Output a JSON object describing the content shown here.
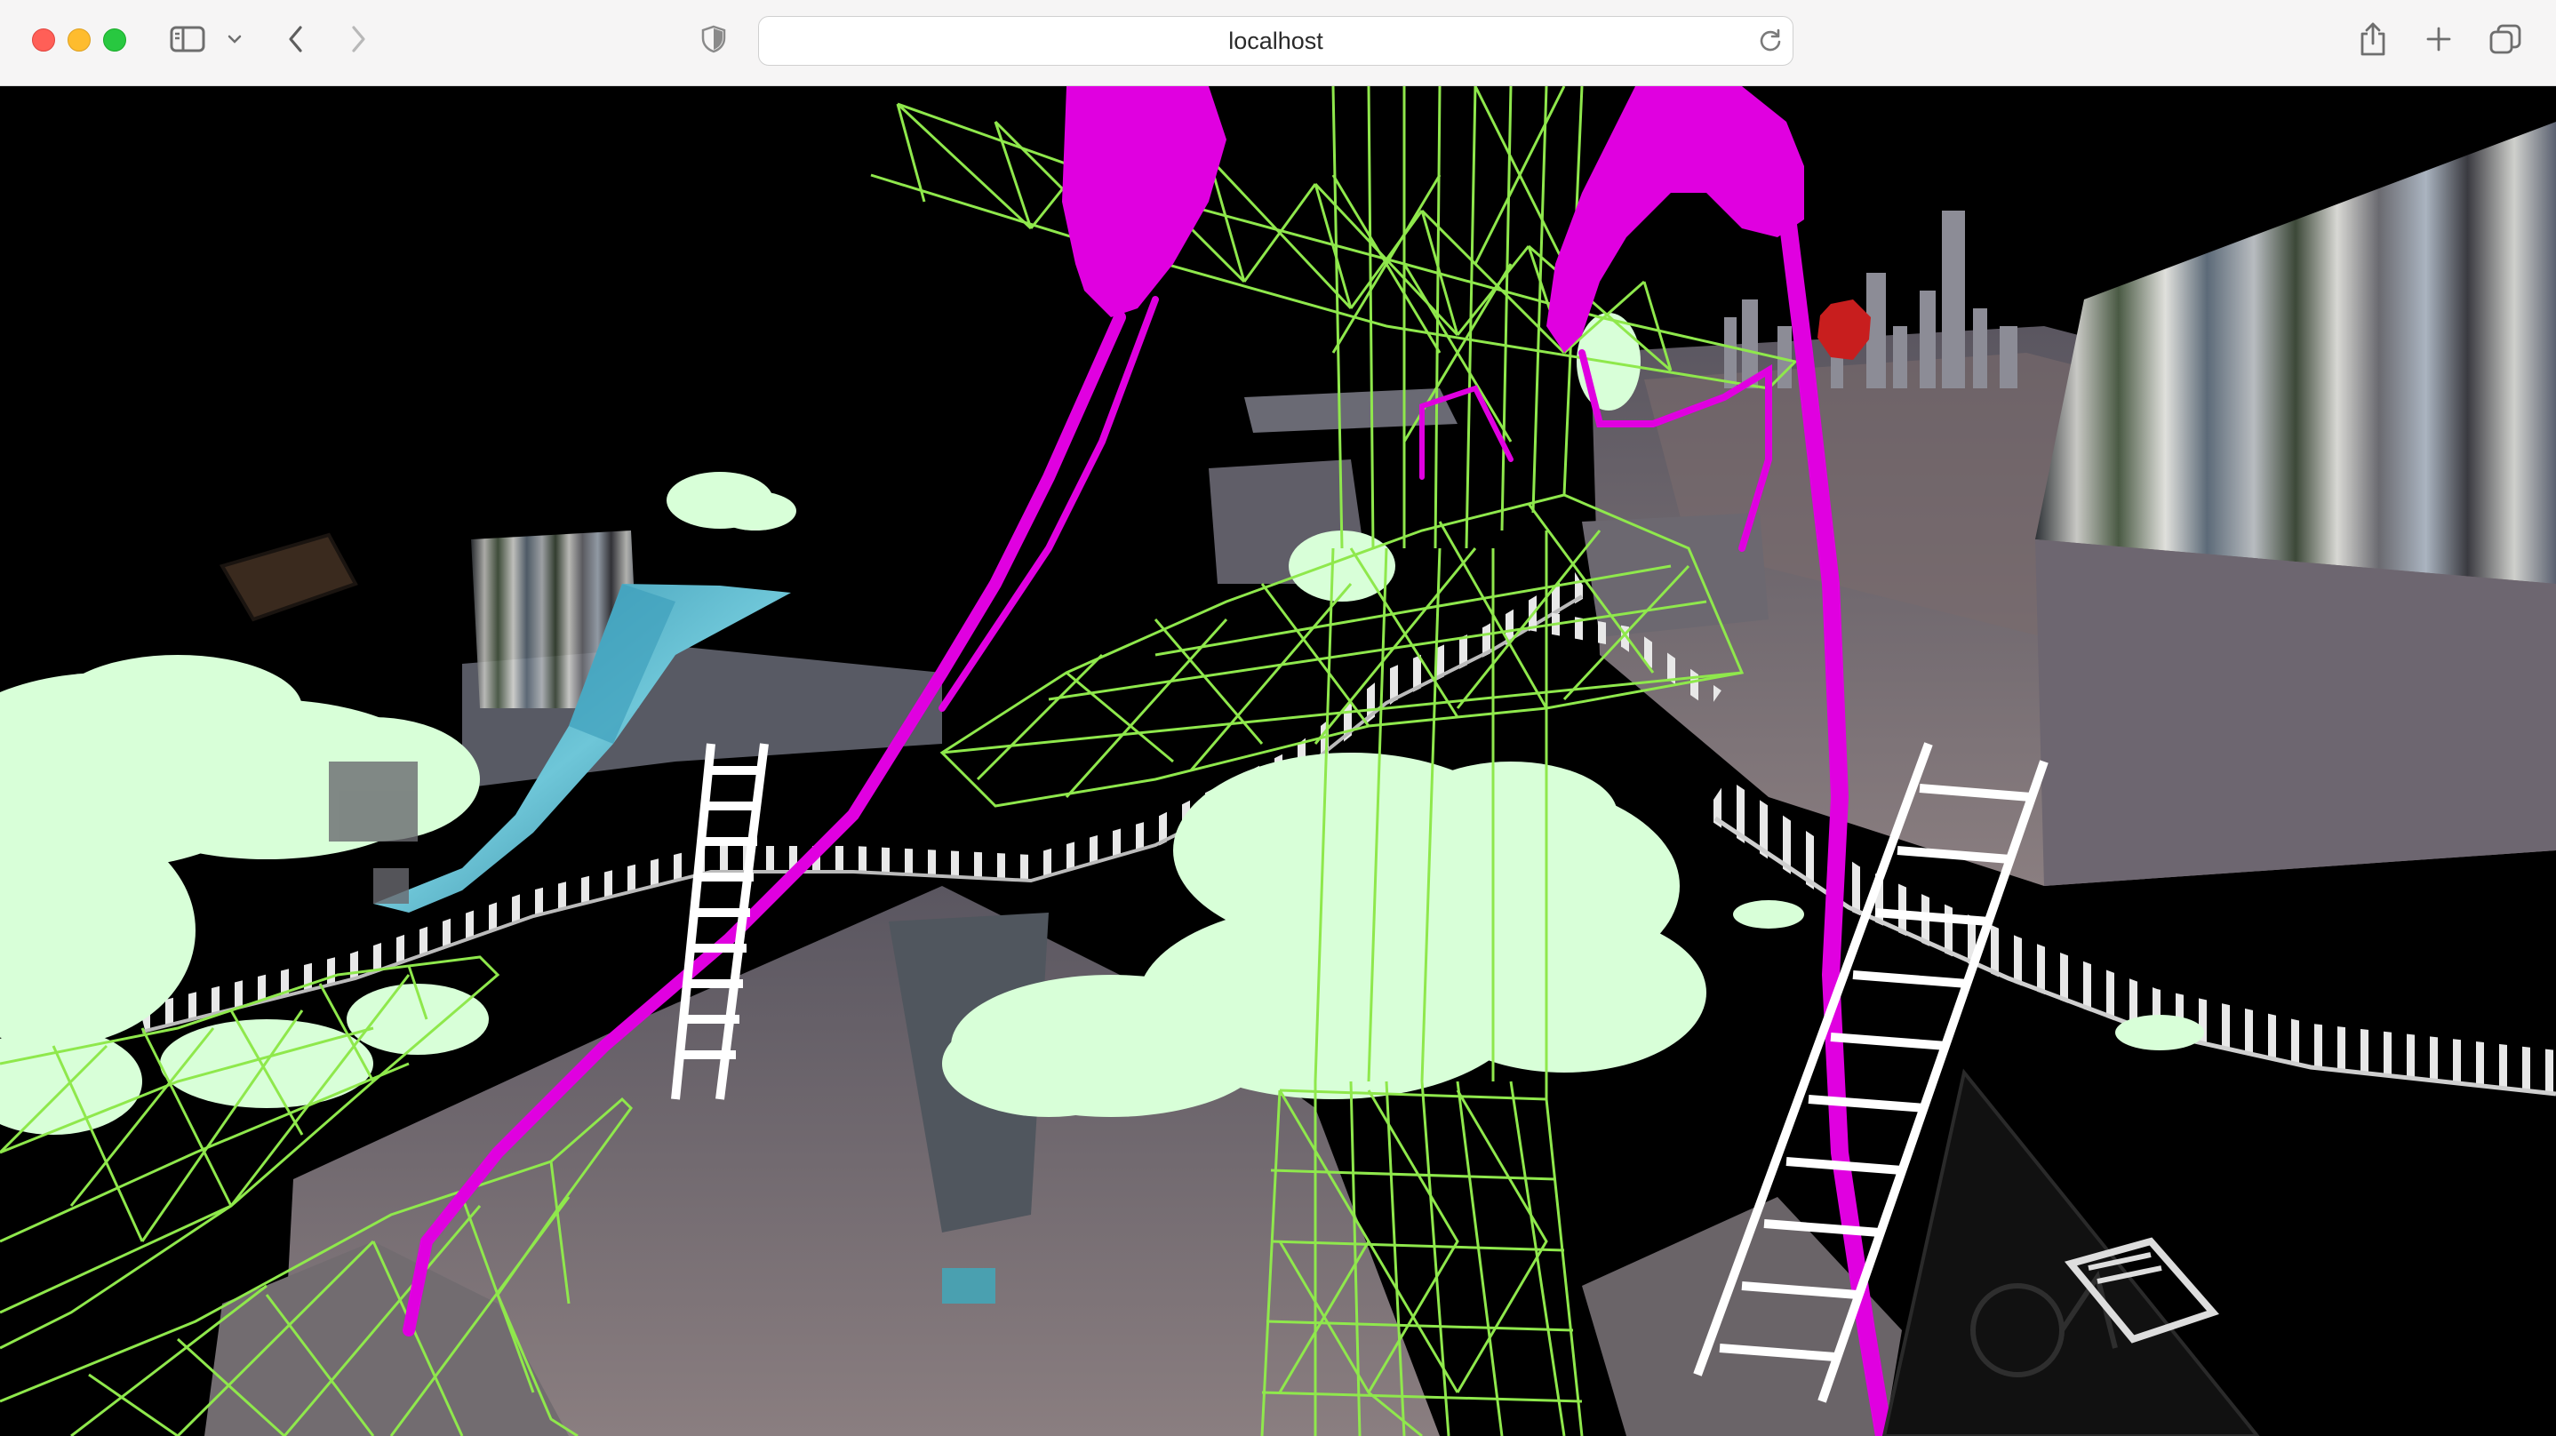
{
  "window": {
    "traffic_lights": {
      "close": "#ff5f57",
      "minimize": "#febc2e",
      "zoom": "#28c840"
    }
  },
  "toolbar": {
    "sidebar_icon": "sidebar-icon",
    "sidebar_menu_icon": "chevron-down-icon",
    "back_icon": "chevron-left-icon",
    "forward_icon": "chevron-right-icon",
    "privacy_icon": "shield-icon",
    "address": "localhost",
    "reload_icon": "reload-icon",
    "share_icon": "share-icon",
    "new_tab_icon": "plus-icon",
    "tab_overview_icon": "tabs-icon"
  },
  "scene": {
    "background": "#000000",
    "colors": {
      "wireframe": "#8fe84c",
      "goo": "#e000e0",
      "clouds": "#d8ffd8",
      "water": "#3aa6c0",
      "ladder": "#ffffff",
      "city": "#6e6a72",
      "stop_sign": "#c81e1e"
    }
  }
}
